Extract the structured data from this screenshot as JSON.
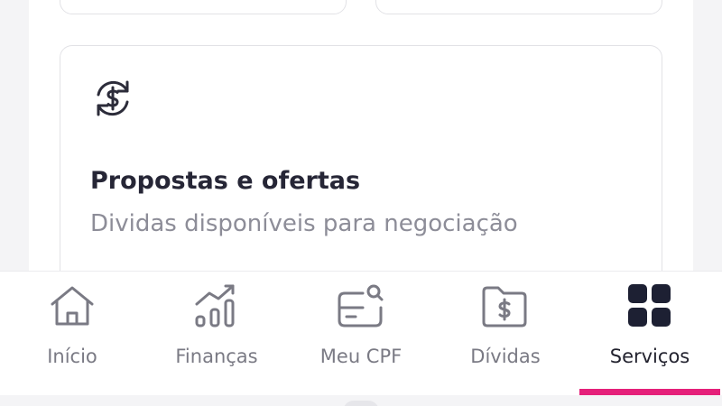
{
  "card": {
    "icon": "money-exchange-icon",
    "title": "Propostas e ofertas",
    "subtitle": "Dividas disponíveis para negociação"
  },
  "nav": {
    "active": "servicos",
    "accent_color": "#e5207a",
    "items": [
      {
        "label": "Início",
        "icon": "home-icon"
      },
      {
        "label": "Finanças",
        "icon": "chart-growth-icon"
      },
      {
        "label": "Meu CPF",
        "icon": "id-card-search-icon"
      },
      {
        "label": "Dívidas",
        "icon": "folder-money-icon"
      },
      {
        "label": "Serviços",
        "icon": "grid-icon"
      }
    ]
  }
}
